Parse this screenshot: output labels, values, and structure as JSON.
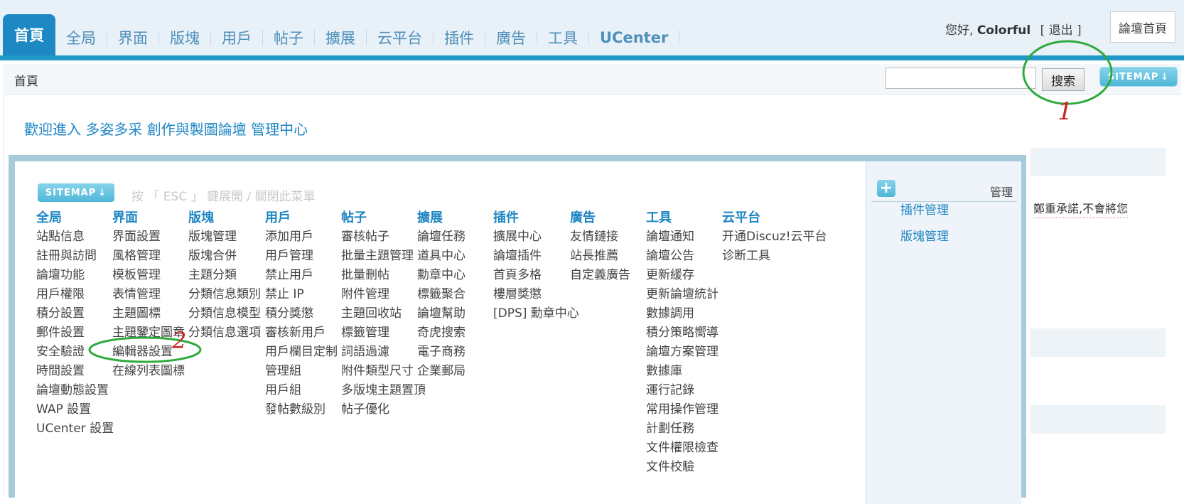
{
  "nav": {
    "items": [
      "首頁",
      "全局",
      "界面",
      "版塊",
      "用戶",
      "帖子",
      "擴展",
      "云平台",
      "插件",
      "廣告",
      "工具",
      "UCenter"
    ]
  },
  "user": {
    "greeting": "您好,",
    "name": "Colorful",
    "logout": "[ 退出 ]",
    "home_link": "論壇首頁"
  },
  "subbar": {
    "breadcrumb": "首頁",
    "search_button": "搜索",
    "sitemap_label": "SITEMAP"
  },
  "welcome": "歡迎進入 多姿多采 創作與製圖論壇 管理中心",
  "background_text": "鄭重承諾,不會將您",
  "sitemap": {
    "button_label": "SITEMAP",
    "hint": "按 「 ESC 」 鍵展開 / 關閉此菜單",
    "columns": [
      {
        "title": "全局",
        "items": [
          "站點信息",
          "註冊與訪問",
          "論壇功能",
          "用戶權限",
          "積分設置",
          "郵件設置",
          "安全驗證",
          "時間設置",
          "論壇動態設置",
          "WAP 設置",
          "UCenter 設置"
        ]
      },
      {
        "title": "界面",
        "items": [
          "界面設置",
          "風格管理",
          "模板管理",
          "表情管理",
          "主題圖標",
          "主題鑒定圖章",
          "編輯器設置",
          "在線列表圖標"
        ]
      },
      {
        "title": "版塊",
        "items": [
          "版塊管理",
          "版塊合併",
          "主題分類",
          "分類信息類別",
          "分類信息模型",
          "分類信息選項"
        ]
      },
      {
        "title": "用戶",
        "items": [
          "添加用戶",
          "用戶管理",
          "禁止用戶",
          "禁止 IP",
          "積分獎懲",
          "審核新用戶",
          "用戶欄目定制",
          "管理組",
          "用戶組",
          "發帖數級別"
        ]
      },
      {
        "title": "帖子",
        "items": [
          "審核帖子",
          "批量主題管理",
          "批量刪帖",
          "附件管理",
          "主題回收站",
          "標籤管理",
          "詞語過濾",
          "附件類型尺寸",
          "多版塊主題置頂",
          "帖子優化"
        ]
      },
      {
        "title": "擴展",
        "items": [
          "論壇任務",
          "道具中心",
          "勳章中心",
          "標籤聚合",
          "論壇幫助",
          "奇虎搜索",
          "電子商務",
          "企業郵局"
        ]
      },
      {
        "title": "插件",
        "items": [
          "擴展中心",
          "論壇插件",
          "首頁多格",
          "樓層獎懲",
          "[DPS] 勳章中心"
        ]
      },
      {
        "title": "廣告",
        "items": [
          "友情鏈接",
          "站長推薦",
          "自定義廣告"
        ]
      },
      {
        "title": "工具",
        "items": [
          "論壇通知",
          "論壇公告",
          "更新緩存",
          "更新論壇統計",
          "數據調用",
          "積分策略嚮導",
          "論壇方案管理",
          "數據庫",
          "運行記錄",
          "常用操作管理",
          "計劃任務",
          "文件權限檢查",
          "文件校驗"
        ]
      },
      {
        "title": "云平台",
        "items": [
          "开通Discuz!云平台",
          "诊断工具"
        ]
      }
    ]
  },
  "right_pane": {
    "plus": "+",
    "title": "管理",
    "items": [
      "插件管理",
      "版塊管理"
    ]
  },
  "annotations": {
    "label1": "1",
    "label2": "2",
    "color": "#cc2222",
    "circle_color": "#2eaa3c"
  }
}
